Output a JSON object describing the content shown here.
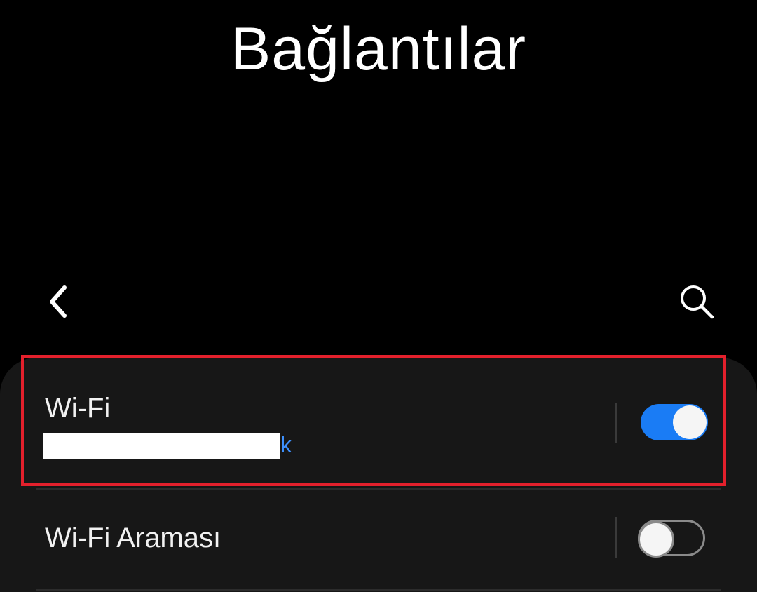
{
  "header": {
    "title": "Bağlantılar",
    "back_icon": "chevron-left-icon",
    "search_icon": "search-icon"
  },
  "settings": {
    "wifi": {
      "label": "Wi-Fi",
      "subtitle_visible": "k",
      "enabled": true
    },
    "wifi_calling": {
      "label": "Wi-Fi Araması",
      "enabled": false
    }
  },
  "colors": {
    "background": "#000000",
    "card": "#171717",
    "accent": "#1a7cf5",
    "subtitle": "#3e91ff",
    "highlight": "#e3202c"
  }
}
